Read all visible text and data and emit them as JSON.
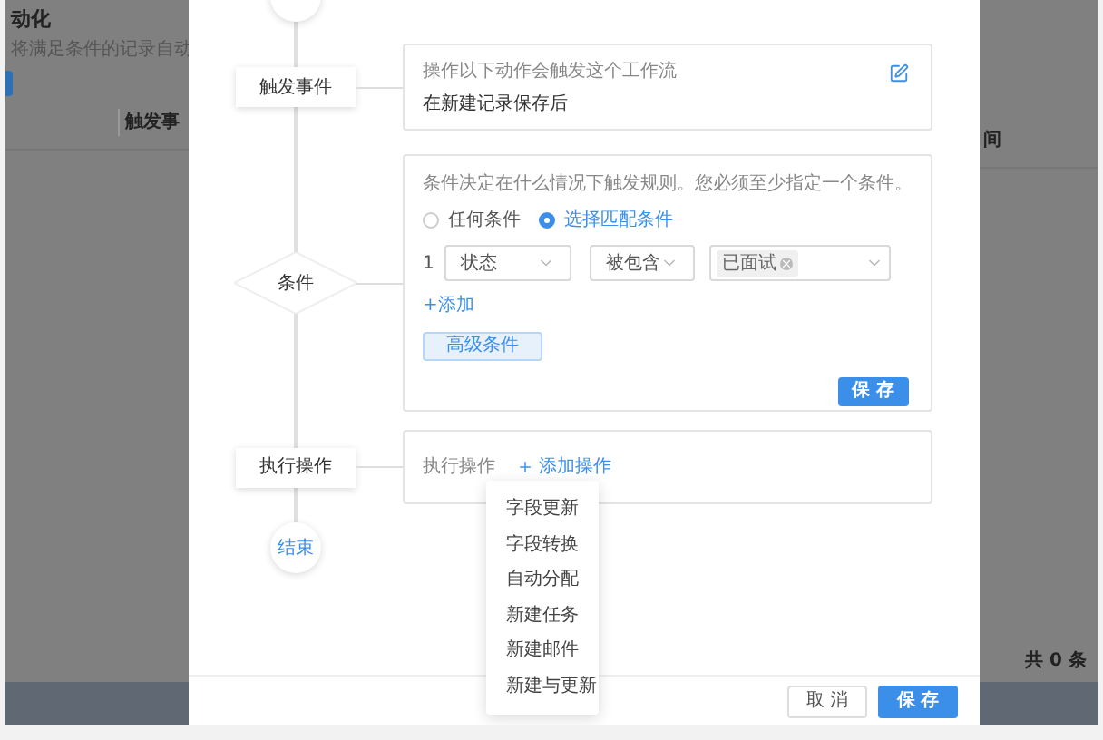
{
  "background_page": {
    "title": "动化",
    "subtitle": "将满足条件的记录自动",
    "column_header_left": "触发事",
    "column_header_right": "间",
    "total": "共 0 条"
  },
  "steps": [
    {
      "kind": "trigger",
      "node": "触发事件",
      "hint": "操作以下动作会触发这个工作流",
      "value": "在新建记录保存后"
    },
    {
      "kind": "condition",
      "node": "条件",
      "hint": "条件决定在什么情况下触发规则。您必须至少指定一个条件。",
      "match_options": [
        {
          "label": "任何条件",
          "selected": false
        },
        {
          "label": "选择匹配条件",
          "selected": true
        }
      ],
      "conditions": [
        {
          "index": "1",
          "field": "状态",
          "operator": "被包含",
          "values": [
            "已面试"
          ]
        }
      ],
      "add_link": "+添加",
      "advanced_button": "高级条件",
      "save_button": "保 存"
    },
    {
      "kind": "action",
      "node": "执行操作",
      "label": "执行操作",
      "add_link": "添加操作"
    }
  ],
  "end_node": "结束",
  "action_menu": {
    "items": [
      "字段更新",
      "字段转换",
      "自动分配",
      "新建任务",
      "新建邮件",
      "新建与更新"
    ]
  },
  "footer": {
    "cancel": "取 消",
    "save": "保 存"
  }
}
